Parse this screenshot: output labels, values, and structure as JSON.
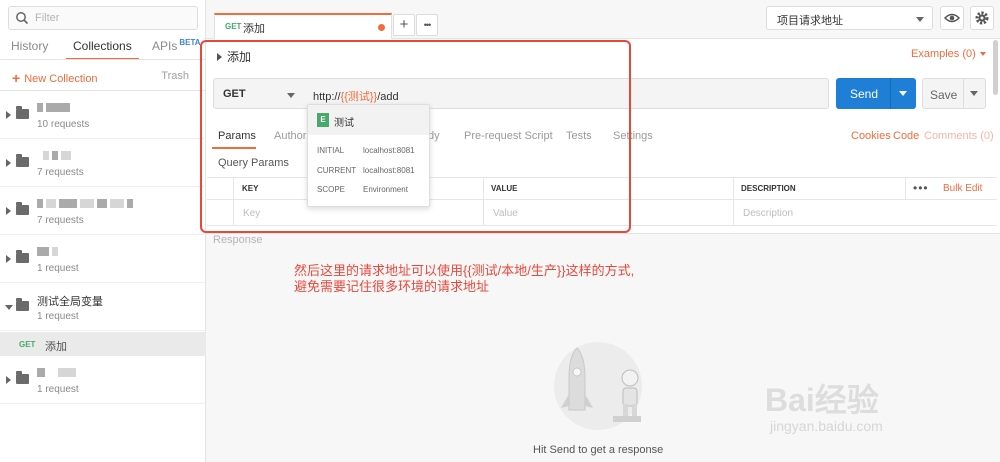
{
  "sidebar": {
    "filter_placeholder": "Filter",
    "tabs": [
      {
        "label": "History",
        "active": false
      },
      {
        "label": "Collections",
        "active": true
      },
      {
        "label": "APIs",
        "badge": "BETA",
        "active": false
      }
    ],
    "new_collection": "New Collection",
    "trash": "Trash",
    "collections": [
      {
        "name": "",
        "requests": "10 requests",
        "expanded": false
      },
      {
        "name": "",
        "requests": "7 requests",
        "expanded": false
      },
      {
        "name": "",
        "requests": "7 requests",
        "expanded": false
      },
      {
        "name": "",
        "requests": "1 request",
        "expanded": false
      },
      {
        "name": "测试全局变量",
        "requests": "1 request",
        "expanded": true
      },
      {
        "name": "",
        "requests": "1 request",
        "expanded": false
      }
    ],
    "request_item": {
      "method": "GET",
      "name": "添加"
    }
  },
  "tabbar": {
    "tab": {
      "method": "GET",
      "name": "添加"
    },
    "add_label": "+",
    "more_label": "•••",
    "environment": "项目请求地址",
    "eye_icon": "eye-icon",
    "settings_icon": "gear-icon"
  },
  "request": {
    "name": "添加",
    "examples": "Examples (0)",
    "method": "GET",
    "url_prefix": "http://",
    "url_variable": "{{测试}}",
    "url_suffix": "/add",
    "send": "Send",
    "save": "Save",
    "tabs": [
      "Params",
      "Authori",
      "dy",
      "Pre-request Script",
      "Tests",
      "Settings"
    ],
    "links": {
      "cookies": "Cookies",
      "code": "Code",
      "comments": "Comments (0)"
    },
    "query_params": "Query Params",
    "table": {
      "headers": [
        "KEY",
        "VALUE",
        "DESCRIPTION"
      ],
      "placeholders": [
        "Key",
        "Value",
        "Description"
      ],
      "more": "•••",
      "bulk_edit": "Bulk Edit"
    }
  },
  "popover": {
    "badge": "E",
    "name": "测试",
    "rows": [
      {
        "k": "INITIAL",
        "v": "localhost:8081"
      },
      {
        "k": "CURRENT",
        "v": "localhost:8081"
      },
      {
        "k": "SCOPE",
        "v": "Environment"
      }
    ]
  },
  "response": {
    "title": "Response",
    "annotation_line1": "然后这里的请求地址可以使用{{测试/本地/生产}}这样的方式,",
    "annotation_line2": "避免需要记住很多环境的请求地址",
    "hint": "Hit Send to get a response"
  },
  "watermark": {
    "main": "Bai经验",
    "sub": "jingyan.baidu.com"
  },
  "colors": {
    "accent": "#f26b3a",
    "send": "#1f7fd6",
    "get": "#47a96a",
    "annotation": "#e8483b"
  }
}
